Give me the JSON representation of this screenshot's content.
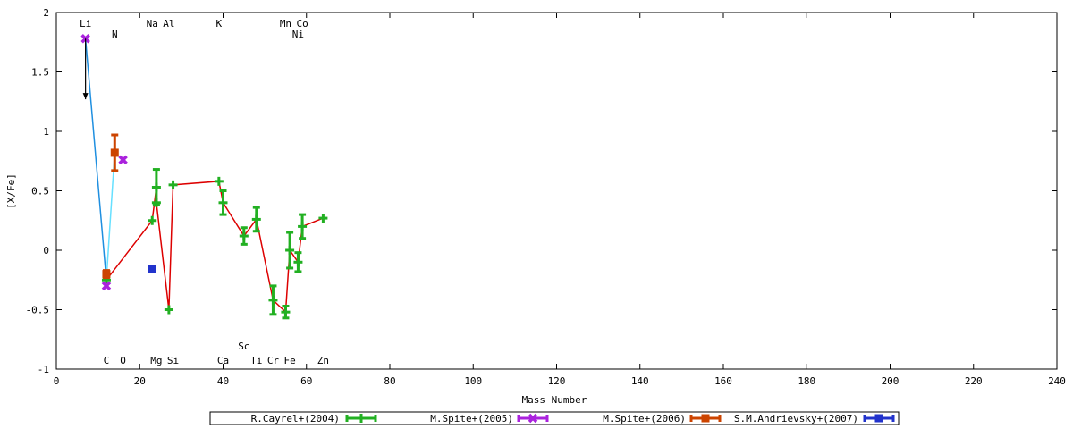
{
  "chart_data": {
    "type": "scatter",
    "title": "",
    "xlabel": "Mass Number",
    "ylabel": "[X/Fe]",
    "xlim": [
      0,
      240
    ],
    "ylim": [
      -1,
      2
    ],
    "xticks": [
      0,
      20,
      40,
      60,
      80,
      100,
      120,
      140,
      160,
      180,
      200,
      220,
      240
    ],
    "yticks": [
      -1,
      -0.5,
      0,
      0.5,
      1,
      1.5,
      2
    ],
    "ytick_labels": [
      "-1",
      "-0.5",
      "0",
      "0.5",
      "1",
      "1.5",
      "2"
    ],
    "grid": false,
    "legend_position": "bottom",
    "element_labels_top": [
      {
        "text": "Li",
        "x": 7,
        "row": 1
      },
      {
        "text": "N",
        "x": 14,
        "row": 2
      },
      {
        "text": "Na",
        "x": 23,
        "row": 1
      },
      {
        "text": "Al",
        "x": 27,
        "row": 1
      },
      {
        "text": "K",
        "x": 39,
        "row": 1
      },
      {
        "text": "Mn",
        "x": 55,
        "row": 1
      },
      {
        "text": "Co",
        "x": 59,
        "row": 1
      },
      {
        "text": "Ni",
        "x": 58,
        "row": 2
      }
    ],
    "element_labels_bottom": [
      {
        "text": "Sc",
        "x": 45,
        "row": 1
      },
      {
        "text": "C",
        "x": 12,
        "row": 2
      },
      {
        "text": "O",
        "x": 16,
        "row": 2
      },
      {
        "text": "Mg",
        "x": 24,
        "row": 2
      },
      {
        "text": "Si",
        "x": 28,
        "row": 2
      },
      {
        "text": "Ca",
        "x": 40,
        "row": 2
      },
      {
        "text": "Ti",
        "x": 48,
        "row": 2
      },
      {
        "text": "Cr",
        "x": 52,
        "row": 2
      },
      {
        "text": "Fe",
        "x": 56,
        "row": 2
      },
      {
        "text": "Zn",
        "x": 64,
        "row": 2
      }
    ],
    "series": [
      {
        "name": "R.Cayrel+(2004)",
        "color": "#22b022",
        "line_color": "#dd0000",
        "marker": "plus",
        "points": [
          {
            "x": 12,
            "y": -0.25,
            "err": 0
          },
          {
            "x": 23,
            "y": 0.25,
            "err": 0
          },
          {
            "x": 24,
            "y": 0.53,
            "err": 0.15
          },
          {
            "x": 24,
            "y": 0.4,
            "err": 0
          },
          {
            "x": 27,
            "y": -0.5,
            "err": 0
          },
          {
            "x": 28,
            "y": 0.55,
            "err": 0
          },
          {
            "x": 39,
            "y": 0.58,
            "err": 0
          },
          {
            "x": 40,
            "y": 0.4,
            "err": 0.1
          },
          {
            "x": 45,
            "y": 0.12,
            "err": 0.07
          },
          {
            "x": 48,
            "y": 0.26,
            "err": 0.1
          },
          {
            "x": 52,
            "y": -0.42,
            "err": 0.12
          },
          {
            "x": 55,
            "y": -0.52,
            "err": 0.05
          },
          {
            "x": 56,
            "y": 0.0,
            "err": 0.15
          },
          {
            "x": 58,
            "y": -0.1,
            "err": 0.08
          },
          {
            "x": 59,
            "y": 0.2,
            "err": 0.1
          },
          {
            "x": 64,
            "y": 0.27,
            "err": 0
          }
        ]
      },
      {
        "name": "M.Spite+(2005)",
        "color": "#aa22dd",
        "line_color": "#33aaff",
        "marker": "cross",
        "points": [
          {
            "x": 7,
            "y": 1.78,
            "err": 0
          },
          {
            "x": 12,
            "y": -0.3,
            "err": 0
          },
          {
            "x": 16,
            "y": 0.76,
            "err": 0
          }
        ]
      },
      {
        "name": "M.Spite+(2006)",
        "color": "#cc4400",
        "line_color": "#33aaff",
        "marker": "square",
        "points": [
          {
            "x": 12,
            "y": -0.2,
            "err": 0.03
          },
          {
            "x": 14,
            "y": 0.82,
            "err": 0.15
          }
        ]
      },
      {
        "name": "S.M.Andrievsky+(2007)",
        "color": "#2233cc",
        "marker": "square",
        "points": [
          {
            "x": 23,
            "y": -0.16,
            "err": 0
          }
        ]
      }
    ],
    "arrow": {
      "x": 7,
      "y_from": 1.78,
      "y_to": 1.27
    }
  }
}
